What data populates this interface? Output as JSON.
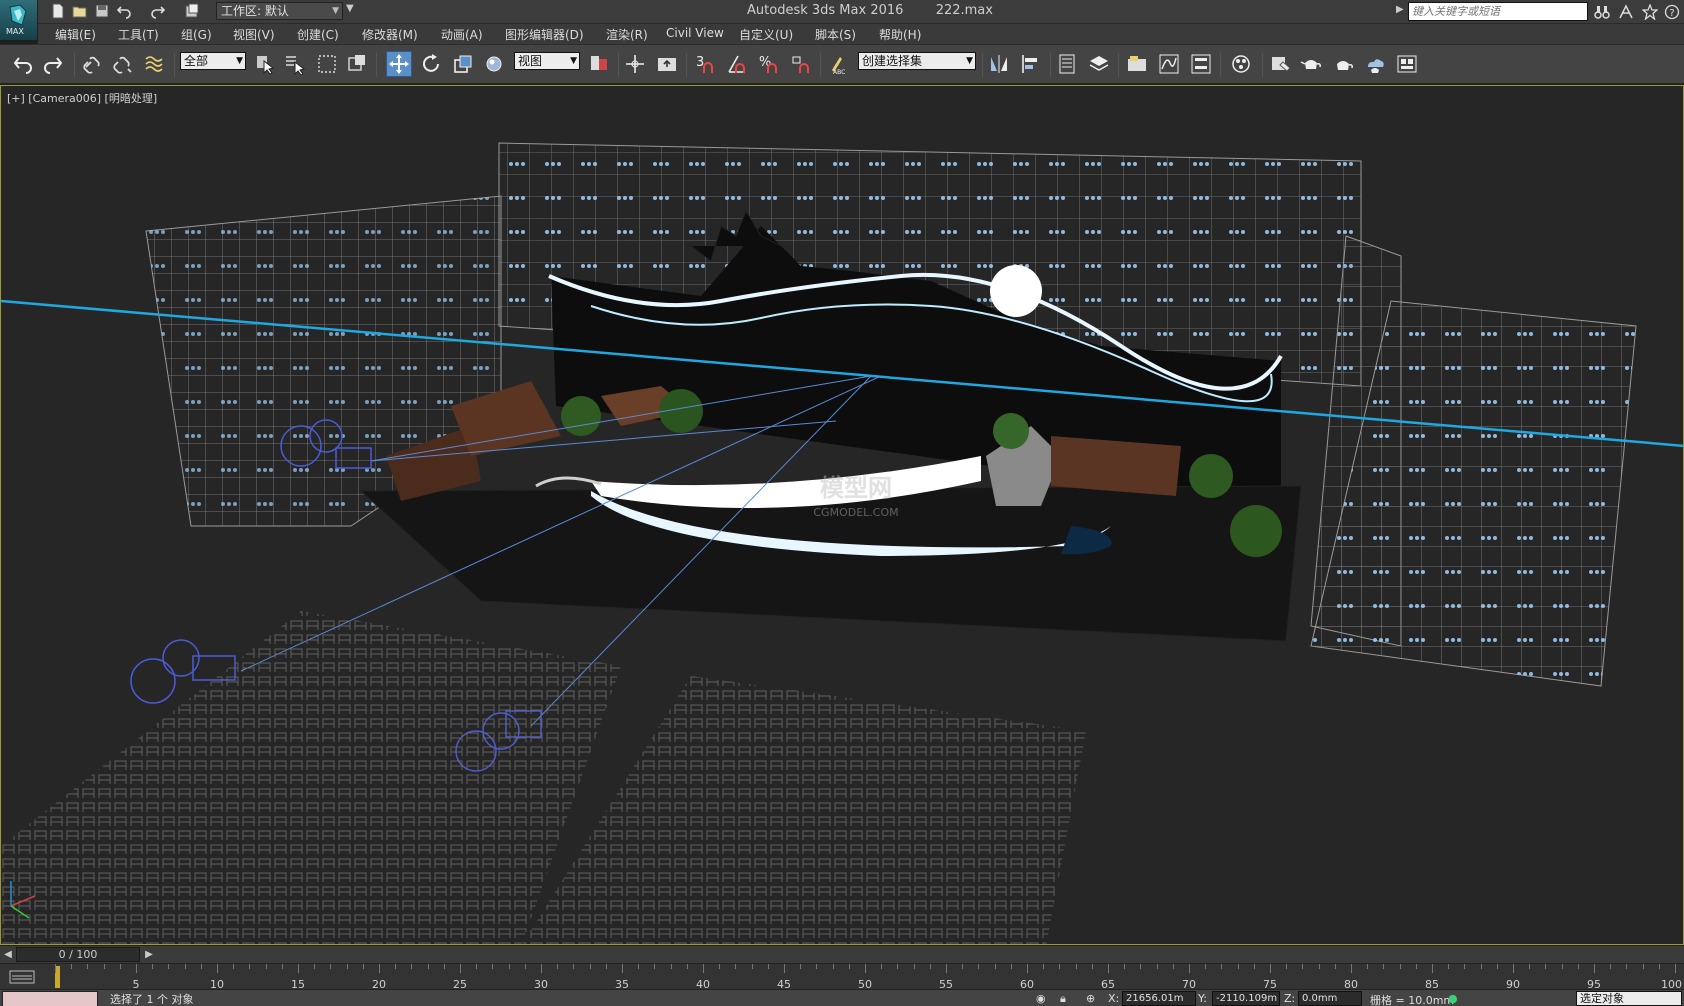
{
  "app": {
    "logo_text": "MAX",
    "window_title": "Autodesk 3ds Max 2016",
    "file_name": "222.max",
    "workspace_label": "工作区: 默认",
    "search_placeholder": "键入关键字或短语"
  },
  "menu": [
    {
      "label": "编辑(E)"
    },
    {
      "label": "工具(T)"
    },
    {
      "label": "组(G)"
    },
    {
      "label": "视图(V)"
    },
    {
      "label": "创建(C)"
    },
    {
      "label": "修改器(M)"
    },
    {
      "label": "动画(A)"
    },
    {
      "label": "图形编辑器(D)"
    },
    {
      "label": "渲染(R)"
    },
    {
      "label": "Civil View"
    },
    {
      "label": "自定义(U)"
    },
    {
      "label": "脚本(S)"
    },
    {
      "label": "帮助(H)"
    }
  ],
  "toolbar": {
    "selection_filter": "全部",
    "reference_coord": "视图",
    "named_selection": "创建选择集",
    "snap_label_3": "3",
    "snap_label_percent": "%",
    "accent_color": "#5b8fc7"
  },
  "viewport": {
    "label": "[+] [Camera006] [明暗处理]",
    "watermark_title": "模型网",
    "watermark_url": "CGMODEL.COM",
    "beam_color": "#1fa8e0",
    "helper_color": "#4b5bd6"
  },
  "timeline": {
    "frame_display": "0 / 100",
    "ticks": [
      "5",
      "10",
      "15",
      "20",
      "25",
      "30",
      "35",
      "40",
      "45",
      "50",
      "55",
      "60",
      "65",
      "70",
      "75",
      "80",
      "85",
      "90",
      "95",
      "100"
    ]
  },
  "status": {
    "selection_text": "选择了 1 个 对象",
    "x_label": "X:",
    "x_value": "21656.01m",
    "y_label": "Y:",
    "y_value": "-2110.109m",
    "z_label": "Z:",
    "z_value": "0.0mm",
    "grid_text": "栅格 = 10.0mm",
    "selected_dropdown": "选定对象"
  }
}
